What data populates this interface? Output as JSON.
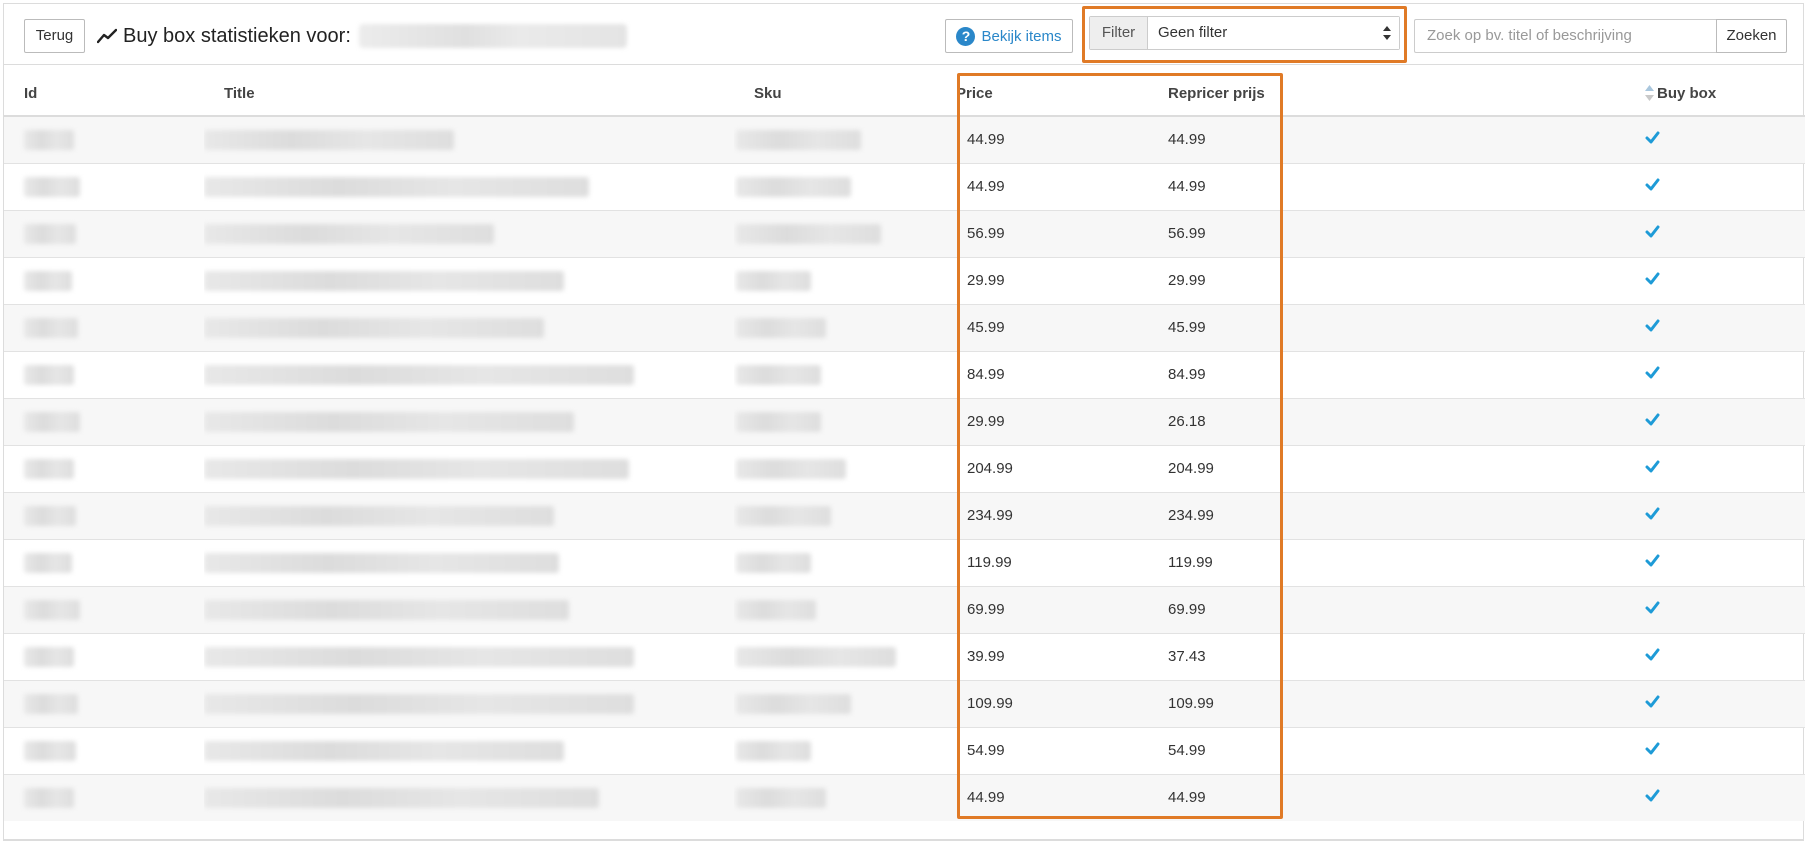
{
  "header": {
    "back_label": "Terug",
    "title": "Buy box statistieken voor:",
    "items_button_label": "Bekijk items",
    "filter_label": "Filter",
    "filter_value": "Geen filter",
    "search_placeholder": "Zoek op bv. titel of beschrijving",
    "search_button_label": "Zoeken"
  },
  "table": {
    "columns": {
      "id": "Id",
      "title": "Title",
      "sku": "Sku",
      "price": "Price",
      "repricer_price": "Repricer prijs",
      "buy_box": "Buy box"
    },
    "rows": [
      {
        "price": "44.99",
        "repricer_price": "44.99",
        "buy_box": true
      },
      {
        "price": "44.99",
        "repricer_price": "44.99",
        "buy_box": true
      },
      {
        "price": "56.99",
        "repricer_price": "56.99",
        "buy_box": true
      },
      {
        "price": "29.99",
        "repricer_price": "29.99",
        "buy_box": true
      },
      {
        "price": "45.99",
        "repricer_price": "45.99",
        "buy_box": true
      },
      {
        "price": "84.99",
        "repricer_price": "84.99",
        "buy_box": true
      },
      {
        "price": "29.99",
        "repricer_price": "26.18",
        "buy_box": true
      },
      {
        "price": "204.99",
        "repricer_price": "204.99",
        "buy_box": true
      },
      {
        "price": "234.99",
        "repricer_price": "234.99",
        "buy_box": true
      },
      {
        "price": "119.99",
        "repricer_price": "119.99",
        "buy_box": true
      },
      {
        "price": "69.99",
        "repricer_price": "69.99",
        "buy_box": true
      },
      {
        "price": "39.99",
        "repricer_price": "37.43",
        "buy_box": true
      },
      {
        "price": "109.99",
        "repricer_price": "109.99",
        "buy_box": true
      },
      {
        "price": "54.99",
        "repricer_price": "54.99",
        "buy_box": true
      },
      {
        "price": "44.99",
        "repricer_price": "44.99",
        "buy_box": true
      }
    ]
  },
  "icons": {
    "trend": "chart-line-icon",
    "help": "question-circle-icon",
    "select": "select-arrows-icon",
    "sort": "sort-icon",
    "check": "check-icon"
  },
  "colors": {
    "accent": "#2a87c9",
    "highlight": "#e07a26",
    "check": "#1e9bd7"
  }
}
